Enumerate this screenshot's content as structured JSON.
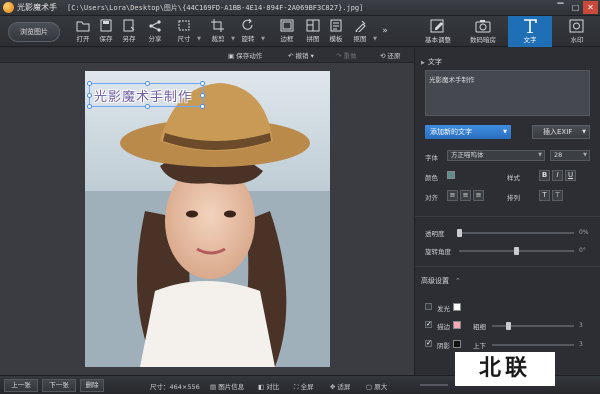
{
  "window": {
    "app_name": "光影魔术手",
    "path": "[C:\\Users\\Lora\\Desktop\\图片\\{44C169FD-A1BB-4E14-894F-2A069BF3C827}.jpg]",
    "controls": [
      "▔",
      "□",
      "✕"
    ]
  },
  "toolbar": {
    "browse_label": "浏览图片",
    "tools": [
      {
        "label": "打开",
        "icon": "folder-icon"
      },
      {
        "label": "保存",
        "icon": "save-icon"
      },
      {
        "label": "另存",
        "icon": "save-as-icon"
      },
      {
        "label": "分享",
        "icon": "share-icon"
      },
      {
        "label": "尺寸",
        "icon": "resize-icon"
      },
      {
        "label": "裁剪",
        "icon": "crop-icon"
      },
      {
        "label": "旋转",
        "icon": "rotate-icon"
      },
      {
        "label": "边框",
        "icon": "frame-icon"
      },
      {
        "label": "拼图",
        "icon": "collage-icon"
      },
      {
        "label": "模板",
        "icon": "template-icon"
      },
      {
        "label": "抠图",
        "icon": "cutout-icon"
      }
    ],
    "more": "»",
    "right_tabs": [
      {
        "label": "基本调整",
        "icon": "adjust-icon"
      },
      {
        "label": "数码暗房",
        "icon": "camera-icon"
      },
      {
        "label": "文字",
        "icon": "text-icon"
      },
      {
        "label": "水印",
        "icon": "watermark-icon"
      }
    ]
  },
  "subbar": {
    "save_action": "保存动作",
    "undo": "撤销",
    "redo": "重做",
    "restore": "还原"
  },
  "canvas": {
    "overlay_text": "光影魔术手制作"
  },
  "panel": {
    "section_title": "文字",
    "text_value": "光影魔术手制作",
    "add_text_btn": "添加新的文字",
    "insert_exif_btn": "插入EXIF",
    "font_label": "字体",
    "font_value": "方正喵呜体",
    "size_value": "28",
    "color_label": "颜色",
    "color_value": "#5c8c8a",
    "style_label": "样式",
    "style_buttons": [
      "B",
      "I",
      "U"
    ],
    "align_label": "对齐",
    "arrange_label": "排列",
    "opacity_label": "透明度",
    "opacity_value": "0%",
    "opacity_level": 0,
    "angle_label": "旋转角度",
    "angle_value": "0°",
    "angle_level": 0.5,
    "advanced_title": "高级设置",
    "glow_label": "发光",
    "stroke_label": "描边",
    "stroke_color": "#f2a9b5",
    "thickness_label": "粗细",
    "thickness_value": "3",
    "thickness_level": 0.2,
    "shadow_label": "阴影",
    "shadow_color": "#111111",
    "up_down_label": "上下",
    "up_down_value": "3"
  },
  "statusbar": {
    "prev": "上一张",
    "next": "下一张",
    "delete": "删除",
    "size_text": "尺寸：464×556",
    "info": "图片信息",
    "compare": "对比",
    "fullscreen": "全屏",
    "fit": "适屏",
    "original": "原大"
  },
  "watermark_logo": "北联"
}
